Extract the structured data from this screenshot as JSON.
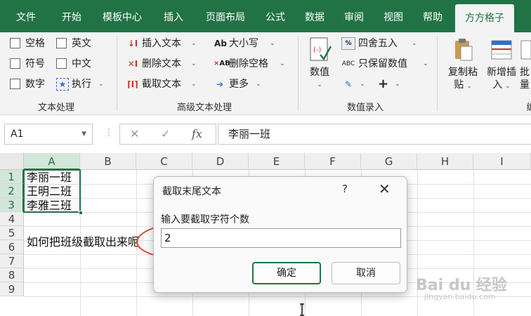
{
  "ribbon_tabs": [
    "文件",
    "开始",
    "模板中心",
    "插入",
    "页面布局",
    "公式",
    "数据",
    "审阅",
    "视图",
    "帮助",
    "方方格子"
  ],
  "active_tab": "方方格子",
  "groups": {
    "text": {
      "label": "文本处理",
      "items": [
        "空格",
        "英文",
        "符号",
        "中文",
        "数字",
        "执行"
      ]
    },
    "advanced": {
      "label": "高级文本处理",
      "items": [
        "插入文本",
        "删除文本",
        "截取文本",
        "大小写",
        "删除空格",
        "更多"
      ]
    },
    "number": {
      "label": "数值录入",
      "big": "数值",
      "items": [
        "四舍五入",
        "只保留数值"
      ]
    },
    "more": {
      "copy_line1": "复制粘",
      "copy_line2": "贴",
      "insert_line1": "新增插",
      "insert_line2": "入",
      "batch_line1": "批",
      "batch_line2": "量",
      "partial_label": "编"
    }
  },
  "formula_bar": {
    "name_box": "A1",
    "fx": "fx",
    "content": "李丽一班"
  },
  "sheet": {
    "columns": [
      "A",
      "B",
      "C",
      "D",
      "E",
      "F",
      "G",
      "H",
      "I"
    ],
    "rows": [
      "1",
      "2",
      "3",
      "4",
      "5",
      "6",
      "7",
      "8",
      "9"
    ],
    "cells": {
      "A1": "李丽一班",
      "A2": "王明二班",
      "A3": "李雅三班",
      "A5": "如何把班级截取出来呢"
    }
  },
  "dialog": {
    "title": "截取末尾文本",
    "help": "?",
    "close": "✕",
    "prompt": "输入要截取字符个数",
    "input_value": "2",
    "ok": "确定",
    "cancel": "取消"
  },
  "watermark": {
    "logo": "Bai du 经验",
    "url": "jingyan.baidu.com"
  },
  "colors": {
    "excel_green": "#217346",
    "annotation_red": "#e53a2a"
  }
}
